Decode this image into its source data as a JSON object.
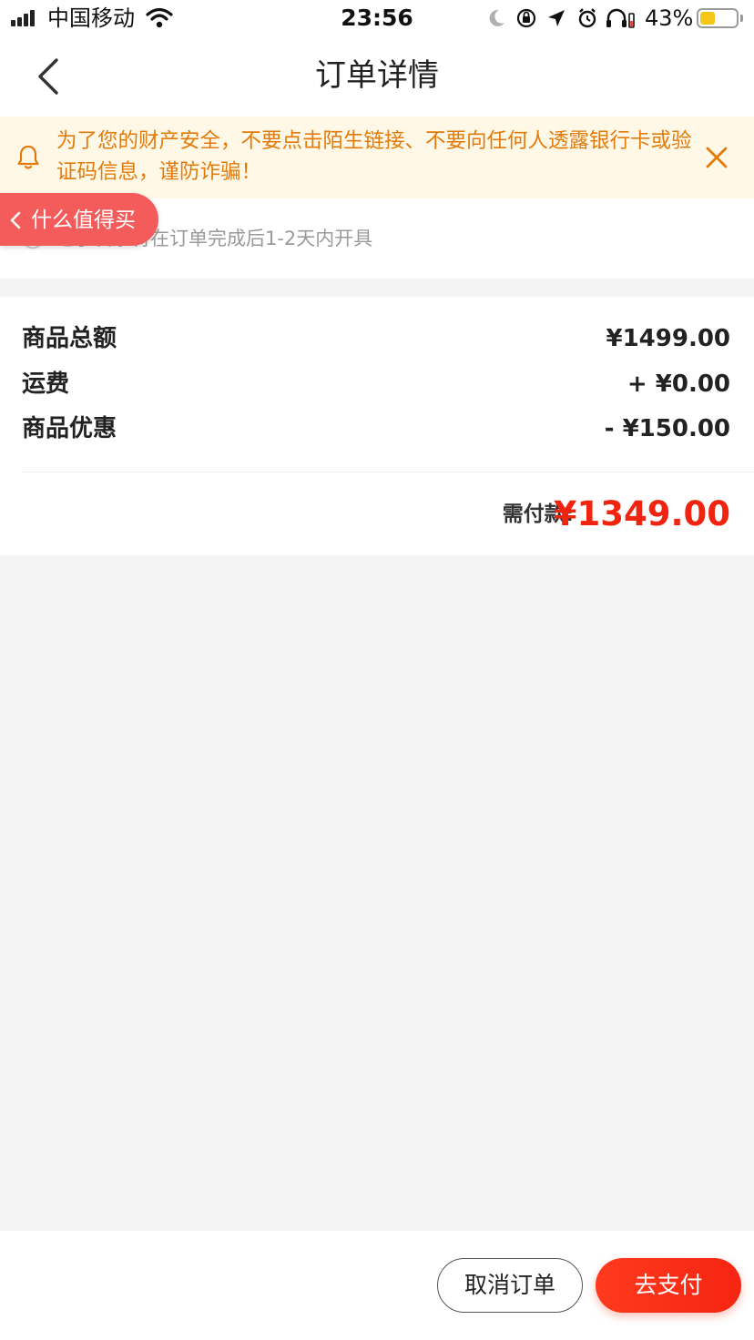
{
  "status_bar": {
    "carrier": "中国移动",
    "time": "23:56",
    "battery_percent": "43%",
    "battery_level": 0.43,
    "icons": [
      "signal-icon",
      "wifi-icon",
      "moon-icon",
      "orientation-lock-icon",
      "location-icon",
      "alarm-icon",
      "headphones-icon",
      "battery-icon"
    ]
  },
  "nav": {
    "title": "订单详情",
    "back_icon": "chevron-left-icon"
  },
  "notice": {
    "text": "为了您的财产安全，不要点击陌生链接、不要向任何人透露银行卡或验证码信息，谨防诈骗！",
    "icon": "bell-icon",
    "close_icon": "close-icon",
    "color": "#e37b0c",
    "background": "#fff8e6"
  },
  "invoice": {
    "text": "电子发票将在订单完成后1-2天内开具",
    "icon": "info-icon"
  },
  "floating_tag": {
    "label": "什么值得买",
    "icon": "chevron-left-icon",
    "color": "#f45c5c"
  },
  "summary": {
    "rows": [
      {
        "label": "商品总额",
        "value": "¥1499.00"
      },
      {
        "label": "运费",
        "value": "+ ¥0.00"
      },
      {
        "label": "商品优惠",
        "value": "- ¥150.00"
      }
    ],
    "pay_label": "需付款:",
    "pay_amount": "¥1349.00",
    "accent_color": "#f0240f"
  },
  "actions": {
    "cancel_label": "取消订单",
    "pay_label": "去支付"
  }
}
